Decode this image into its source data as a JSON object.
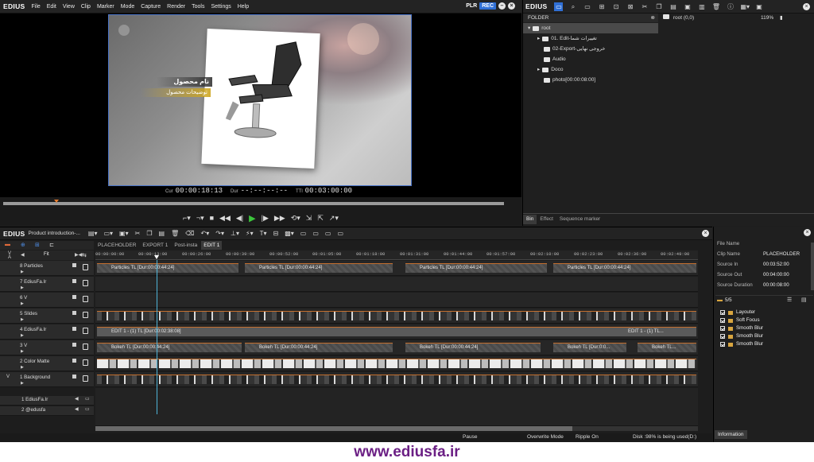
{
  "app": {
    "logo": "EDIUS",
    "menu": [
      "File",
      "Edit",
      "View",
      "Clip",
      "Marker",
      "Mode",
      "Capture",
      "Render",
      "Tools",
      "Settings",
      "Help"
    ],
    "plr": "PLR",
    "rec": "REC"
  },
  "player": {
    "overlay_title": "نام محصول",
    "overlay_subtitle": "توضیحات محصول",
    "tc_cur_label": "Cur",
    "tc_cur": "00:00:18:13",
    "tc_dur_label": "Dur",
    "tc_dur": "--:--:--:--",
    "tc_ttl_label": "TTl",
    "tc_ttl": "00:03:00:00"
  },
  "bin": {
    "logo": "EDIUS",
    "folder_header": "FOLDER",
    "tree": [
      {
        "label": "root"
      },
      {
        "label": "01. Edit-تغییرات شما"
      },
      {
        "label": "02-Export-خروجی نهایی"
      },
      {
        "label": "Audio"
      },
      {
        "label": "Doco"
      },
      {
        "label": "photo[00:00:08:00]"
      }
    ],
    "right_label": "root (0,0)",
    "zoom": "119%",
    "tabs": [
      "Bin",
      "Effect",
      "Sequence marker"
    ]
  },
  "timeline": {
    "logo": "EDIUS",
    "project": "Product introduction-...",
    "sequence_tabs": [
      "PLACEHOLDER",
      "EXPORT 1",
      "Post-insta",
      "EDIT 1"
    ],
    "fit_label": "Fit",
    "ruler": [
      "00:00:00:00",
      "00:00:13:00",
      "00:00:26:00",
      "00:00:39:00",
      "00:00:52:00",
      "00:01:05:00",
      "00:01:18:00",
      "00:01:31:00",
      "00:01:44:00",
      "00:01:57:00",
      "00:02:10:00",
      "00:02:23:00",
      "00:02:36:00",
      "00:02:49:00"
    ],
    "tracks": [
      {
        "name": "8 Particles"
      },
      {
        "name": "7 EdiusFa.Ir"
      },
      {
        "name": "6 V"
      },
      {
        "name": "5 Slides"
      },
      {
        "name": "4 EdiusFa.Ir"
      },
      {
        "name": "3 V"
      },
      {
        "name": "2 Color Matte"
      },
      {
        "name": "1 Background"
      }
    ],
    "audio_tracks": [
      {
        "name": "1 EdiusFa.Ir"
      },
      {
        "name": "2 @edusfa"
      }
    ],
    "clip_particles": "Particles  TL [Dur:00:00:44:24]",
    "clip_edit_a": "EDIT 1 - (1)  TL [Dur:00:02:38:08]",
    "clip_edit_b": "EDIT 1 - (1)  TL...",
    "clip_bokeh": "Bokeh  TL [Dur:00:00:44:24]",
    "clip_bokeh_b": "Bokeh  TL [Dur:0:0...",
    "clip_bokeh_c": "Bokeh  TL...",
    "status": {
      "mode": "Pause",
      "overwrite": "Overwrite Mode",
      "ripple": "Ripple On",
      "disk": "Disk :98% is being used(D:)"
    }
  },
  "info": {
    "rows": [
      {
        "label": "File Name",
        "value": ""
      },
      {
        "label": "Clip Name",
        "value": "PLACEHOLDER"
      },
      {
        "label": "Source In",
        "value": "00:03:52:00"
      },
      {
        "label": "Source Out",
        "value": "00:04:00:00"
      },
      {
        "label": "Source Duration",
        "value": "00:00:08:00"
      }
    ],
    "fx_count": "5/5",
    "effects": [
      "Layouter",
      "Soft Focus",
      "Smooth Blur",
      "Smooth Blur",
      "Smooth Blur"
    ],
    "tab": "Information"
  },
  "watermark": "www.ediusfa.ir",
  "colors": {
    "accent": "#2f6fd6",
    "clip_edge": "#c46f2e",
    "playhead": "#4fb4d8",
    "watermark": "#6b1f84"
  }
}
